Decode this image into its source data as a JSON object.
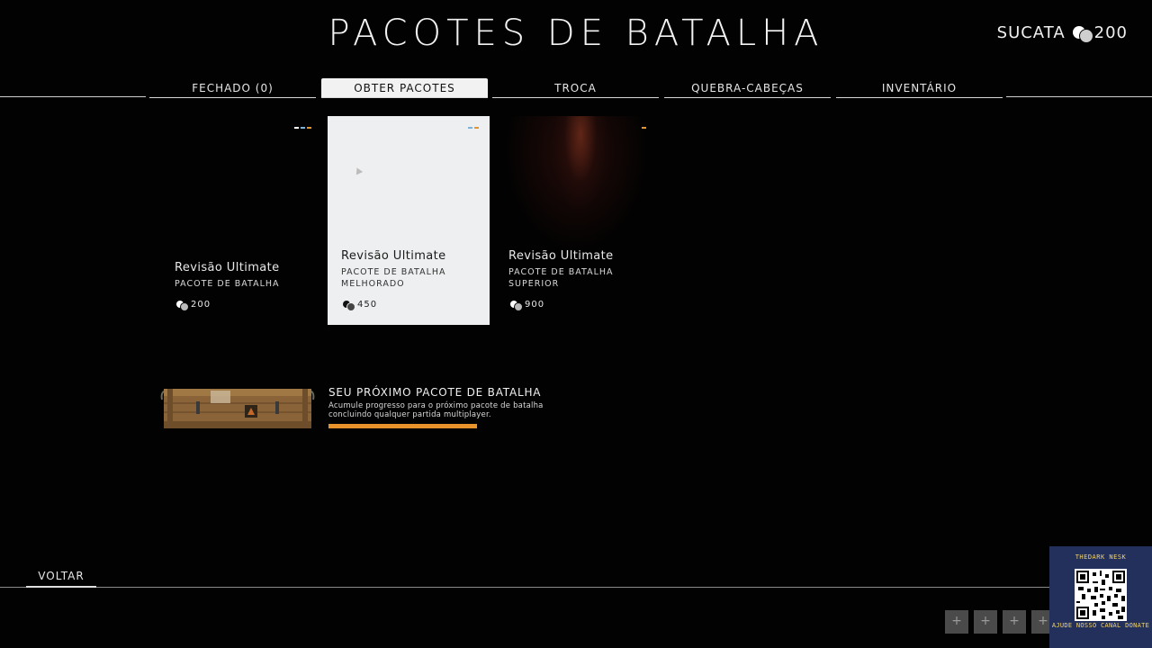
{
  "header": {
    "title": "PACOTES DE BATALHA",
    "currency_label": "SUCATA",
    "currency_value": "200"
  },
  "tabs": [
    {
      "label": "FECHADO (0)",
      "active": false
    },
    {
      "label": "OBTER PACOTES",
      "active": true
    },
    {
      "label": "TROCA",
      "active": false
    },
    {
      "label": "QUEBRA-CABEÇAS",
      "active": false
    },
    {
      "label": "INVENTÁRIO",
      "active": false
    }
  ],
  "packs": [
    {
      "name": "Revisão Ultimate",
      "type": "PACOTE DE BATALHA",
      "price": "200",
      "tier_colors": [
        "#ffffff",
        "#7db3d8",
        "#e8922c"
      ]
    },
    {
      "name": "Revisão Ultimate",
      "type": "PACOTE DE BATALHA MELHORADO",
      "price": "450",
      "tier_colors": [
        "#7db3d8",
        "#e8922c"
      ]
    },
    {
      "name": "Revisão Ultimate",
      "type": "PACOTE DE BATALHA SUPERIOR",
      "price": "900",
      "tier_colors": [
        "#e8922c"
      ]
    }
  ],
  "next_pack": {
    "title": "SEU PRÓXIMO PACOTE DE BATALHA",
    "description": "Acumule progresso para o próximo pacote de batalha concluindo qualquer partida multiplayer.",
    "progress": 1.0
  },
  "footer": {
    "back_label": "VOLTAR",
    "buttons": [
      "+",
      "+",
      "+",
      "+"
    ]
  },
  "overlay": {
    "channel": "THEDARK NESK",
    "caption": "AJUDE NOSSO CANAL DONATE"
  },
  "colors": {
    "accent": "#e8922c",
    "tier_blue": "#7db3d8",
    "background": "#020202",
    "overlay_bg": "#24305c"
  }
}
